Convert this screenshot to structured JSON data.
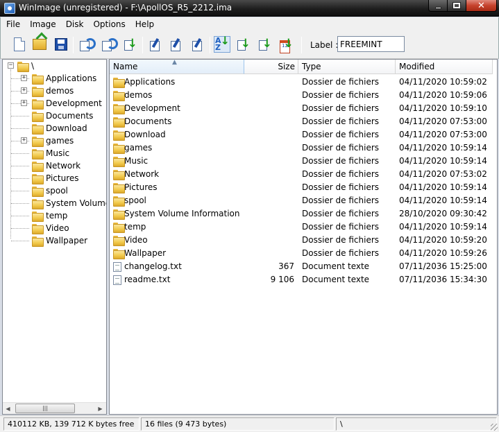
{
  "window": {
    "title": "WinImage (unregistered) - F:\\ApollOS_R5_2212.ima"
  },
  "menu": [
    "File",
    "Image",
    "Disk",
    "Options",
    "Help"
  ],
  "toolbar": {
    "label_caption": "Label :",
    "label_value": "FREEMINT"
  },
  "tree": {
    "root": "\\",
    "items": [
      {
        "label": "Applications",
        "expandable": true
      },
      {
        "label": "demos",
        "expandable": true
      },
      {
        "label": "Development",
        "expandable": true
      },
      {
        "label": "Documents",
        "expandable": false
      },
      {
        "label": "Download",
        "expandable": false
      },
      {
        "label": "games",
        "expandable": true
      },
      {
        "label": "Music",
        "expandable": false
      },
      {
        "label": "Network",
        "expandable": false
      },
      {
        "label": "Pictures",
        "expandable": false
      },
      {
        "label": "spool",
        "expandable": false
      },
      {
        "label": "System Volume I",
        "expandable": false
      },
      {
        "label": "temp",
        "expandable": false
      },
      {
        "label": "Video",
        "expandable": false
      },
      {
        "label": "Wallpaper",
        "expandable": false
      }
    ],
    "scroll_thumb": "|||"
  },
  "list": {
    "columns": {
      "name": "Name",
      "size": "Size",
      "type": "Type",
      "modified": "Modified"
    },
    "rows": [
      {
        "name": "Applications",
        "size": "",
        "type": "Dossier de fichiers",
        "modified": "04/11/2020  10:59:02",
        "kind": "folder"
      },
      {
        "name": "demos",
        "size": "",
        "type": "Dossier de fichiers",
        "modified": "04/11/2020  10:59:06",
        "kind": "folder"
      },
      {
        "name": "Development",
        "size": "",
        "type": "Dossier de fichiers",
        "modified": "04/11/2020  10:59:10",
        "kind": "folder"
      },
      {
        "name": "Documents",
        "size": "",
        "type": "Dossier de fichiers",
        "modified": "04/11/2020  07:53:00",
        "kind": "folder"
      },
      {
        "name": "Download",
        "size": "",
        "type": "Dossier de fichiers",
        "modified": "04/11/2020  07:53:00",
        "kind": "folder"
      },
      {
        "name": "games",
        "size": "",
        "type": "Dossier de fichiers",
        "modified": "04/11/2020  10:59:14",
        "kind": "folder"
      },
      {
        "name": "Music",
        "size": "",
        "type": "Dossier de fichiers",
        "modified": "04/11/2020  10:59:14",
        "kind": "folder"
      },
      {
        "name": "Network",
        "size": "",
        "type": "Dossier de fichiers",
        "modified": "04/11/2020  07:53:02",
        "kind": "folder"
      },
      {
        "name": "Pictures",
        "size": "",
        "type": "Dossier de fichiers",
        "modified": "04/11/2020  10:59:14",
        "kind": "folder"
      },
      {
        "name": "spool",
        "size": "",
        "type": "Dossier de fichiers",
        "modified": "04/11/2020  10:59:14",
        "kind": "folder"
      },
      {
        "name": "System Volume Information",
        "size": "",
        "type": "Dossier de fichiers",
        "modified": "28/10/2020  09:30:42",
        "kind": "folder"
      },
      {
        "name": "temp",
        "size": "",
        "type": "Dossier de fichiers",
        "modified": "04/11/2020  10:59:14",
        "kind": "folder"
      },
      {
        "name": "Video",
        "size": "",
        "type": "Dossier de fichiers",
        "modified": "04/11/2020  10:59:20",
        "kind": "folder"
      },
      {
        "name": "Wallpaper",
        "size": "",
        "type": "Dossier de fichiers",
        "modified": "04/11/2020  10:59:26",
        "kind": "folder"
      },
      {
        "name": "changelog.txt",
        "size": "367",
        "type": "Document texte",
        "modified": "07/11/2036  15:25:00",
        "kind": "text"
      },
      {
        "name": "readme.txt",
        "size": "9 106",
        "type": "Document texte",
        "modified": "07/11/2036  15:34:30",
        "kind": "text"
      }
    ]
  },
  "status": {
    "free": "410112 KB, 139 712 K bytes free",
    "files": "16 files (9 473 bytes)",
    "path": "\\"
  }
}
